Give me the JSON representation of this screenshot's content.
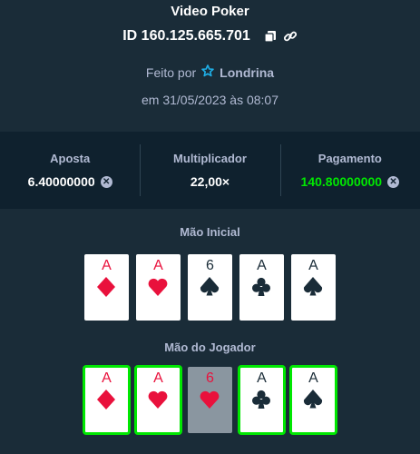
{
  "header": {
    "title": "Video Poker",
    "bet_id": "ID 160.125.665.701",
    "made_by_label": "Feito por",
    "username": "Londrina",
    "date": "em 31/05/2023 às 08:07"
  },
  "stats": {
    "bet_label": "Aposta",
    "bet_value": "6.40000000",
    "multiplier_label": "Multiplicador",
    "multiplier_value": "22,00×",
    "payout_label": "Pagamento",
    "payout_value": "140.80000000"
  },
  "initial_hand": {
    "label": "Mão Inicial",
    "cards": [
      {
        "rank": "A",
        "suit": "diamond",
        "color": "red"
      },
      {
        "rank": "A",
        "suit": "heart",
        "color": "red"
      },
      {
        "rank": "6",
        "suit": "spade",
        "color": "black"
      },
      {
        "rank": "A",
        "suit": "club",
        "color": "black"
      },
      {
        "rank": "A",
        "suit": "spade",
        "color": "black"
      }
    ]
  },
  "player_hand": {
    "label": "Mão do Jogador",
    "cards": [
      {
        "rank": "A",
        "suit": "diamond",
        "color": "red",
        "held": true
      },
      {
        "rank": "A",
        "suit": "heart",
        "color": "red",
        "held": true
      },
      {
        "rank": "6",
        "suit": "heart",
        "color": "red",
        "held": false
      },
      {
        "rank": "A",
        "suit": "club",
        "color": "black",
        "held": true
      },
      {
        "rank": "A",
        "suit": "spade",
        "color": "black",
        "held": true
      }
    ]
  },
  "colors": {
    "background": "#1a2c38",
    "panel": "#0f212e",
    "accent_green": "#00e701",
    "muted_text": "#b1bad3",
    "card_red": "#e9113c"
  }
}
